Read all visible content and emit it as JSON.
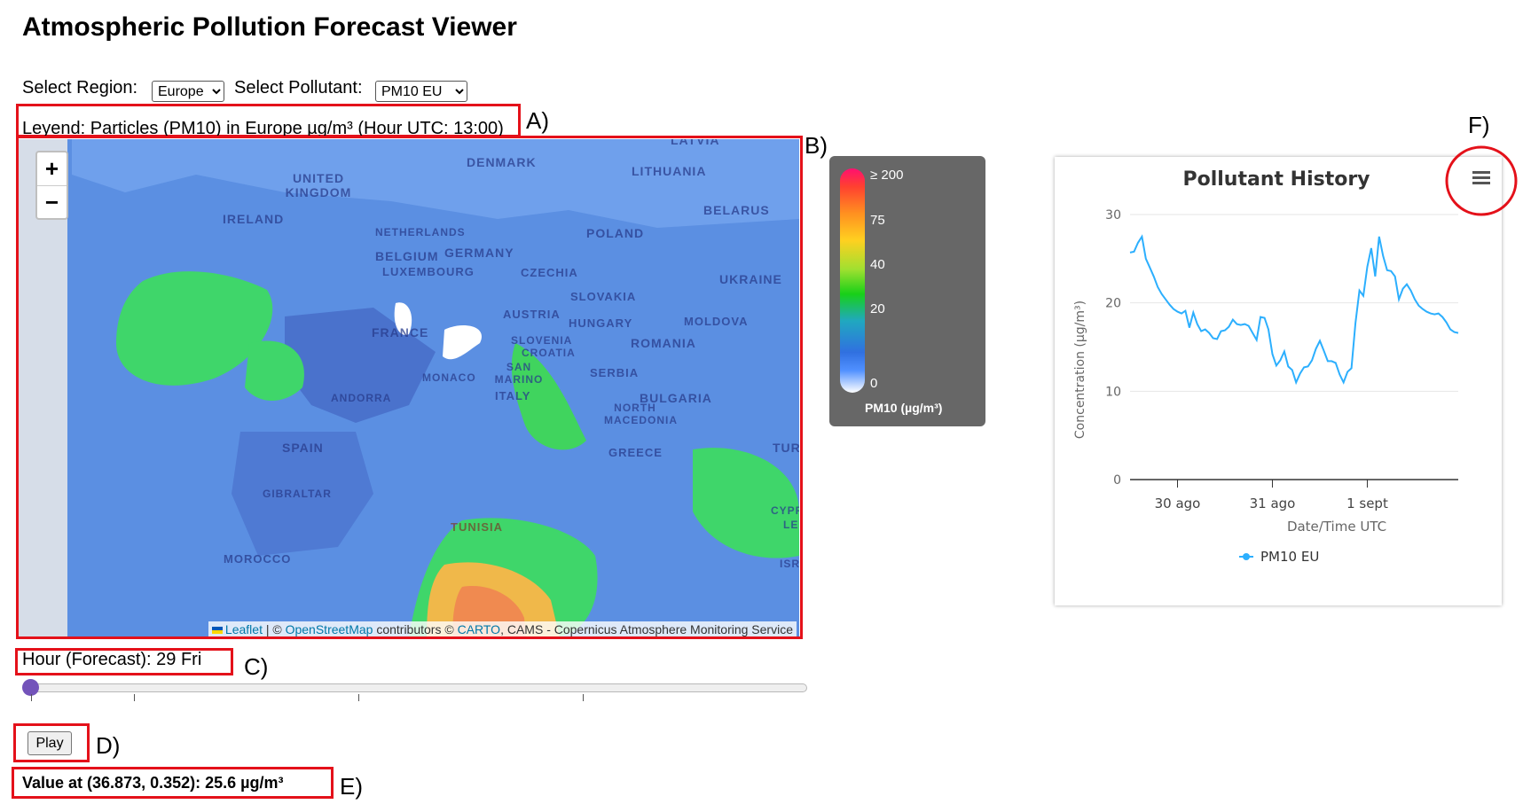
{
  "app": {
    "title": "Atmospheric Pollution Forecast Viewer"
  },
  "controls": {
    "region_label": "Select Region:",
    "region_value": "Europe",
    "pollutant_label": "Select Pollutant:",
    "pollutant_value": "PM10 EU"
  },
  "legend_text": "Leyend: Particles (PM10) in Europe µg/m³ (Hour UTC: 13:00)",
  "annotations": {
    "a": "A)",
    "b": "B)",
    "c": "C)",
    "d": "D)",
    "e": "E)",
    "f": "F)"
  },
  "map": {
    "zoom_in": "+",
    "zoom_out": "−",
    "attribution": {
      "leaflet": "Leaflet",
      "sep1": " | © ",
      "osm": "OpenStreetMap",
      "mid": " contributors © ",
      "carto": "CARTO",
      "rest": ", CAMS - Copernicus Atmosphere Monitoring Service"
    },
    "countries": [
      "LATVIA",
      "DENMARK",
      "LITHUANIA",
      "UNITED KINGDOM",
      "IRELAND",
      "BELARUS",
      "NETHERLANDS",
      "POLAND",
      "BELGIUM",
      "GERMANY",
      "LUXEMBOURG",
      "CZECHIA",
      "UKRAINE",
      "SLOVAKIA",
      "AUSTRIA",
      "HUNGARY",
      "MOLDOVA",
      "FRANCE",
      "SLOVENIA",
      "CROATIA",
      "ROMANIA",
      "SAN MARINO",
      "MONACO",
      "SERBIA",
      "ITALY",
      "ANDORRA",
      "BULGARIA",
      "NORTH MACEDONIA",
      "SPAIN",
      "GREECE",
      "TUR",
      "GIBRALTAR",
      "TUNISIA",
      "CYPRUS",
      "LEB",
      "MOROCCO",
      "ISR"
    ]
  },
  "colorbar": {
    "ticks": [
      "≥ 200",
      "75",
      "40",
      "20",
      "0"
    ],
    "title": "PM10 (µg/m³)"
  },
  "hour": {
    "label": "Hour (Forecast): 29 Fri",
    "slider_position": 0
  },
  "play_label": "Play",
  "value_readout": "Value at (36.873, 0.352): 25.6 µg/m³",
  "chart_data": {
    "type": "line",
    "title": "Pollutant History",
    "xlabel": "Date/Time UTC",
    "ylabel": "Concentration (µg/m³)",
    "ylim": [
      0,
      30
    ],
    "yticks": [
      "0",
      "10",
      "20",
      "30"
    ],
    "xticks": [
      "30 ago",
      "31 ago",
      "1 sept"
    ],
    "xticks_hours": [
      24,
      48,
      72
    ],
    "x_range_hours": [
      12,
      95
    ],
    "grid": true,
    "legend_position": "bottom",
    "series": [
      {
        "name": "PM10 EU",
        "color": "#2caffe",
        "x_hours": [
          12,
          13,
          14,
          15,
          16,
          17,
          18,
          19,
          20,
          21,
          22,
          23,
          24,
          25,
          26,
          27,
          28,
          29,
          30,
          31,
          32,
          33,
          34,
          35,
          36,
          37,
          38,
          39,
          40,
          41,
          42,
          43,
          44,
          45,
          46,
          47,
          48,
          49,
          50,
          51,
          52,
          53,
          54,
          55,
          56,
          57,
          58,
          59,
          60,
          61,
          62,
          63,
          64,
          65,
          66,
          67,
          68,
          69,
          70,
          71,
          72,
          73,
          74,
          75,
          76,
          77,
          78,
          79,
          80,
          81,
          82,
          83,
          84,
          85,
          86,
          87,
          88,
          89,
          90,
          91,
          92,
          93,
          94,
          95
        ],
        "values": [
          25.7,
          25.8,
          26.8,
          27.5,
          25.0,
          24.0,
          23.0,
          21.8,
          21.0,
          20.4,
          19.8,
          19.3,
          19.0,
          18.8,
          19.1,
          17.2,
          18.9,
          17.6,
          16.8,
          17.0,
          16.6,
          16.0,
          15.9,
          16.8,
          16.9,
          17.3,
          18.1,
          17.6,
          17.5,
          17.6,
          17.4,
          16.6,
          15.8,
          18.4,
          18.3,
          17.0,
          14.2,
          12.9,
          13.5,
          14.5,
          12.8,
          12.4,
          11.0,
          12.0,
          12.7,
          12.8,
          13.5,
          14.8,
          15.7,
          14.6,
          13.4,
          13.4,
          13.2,
          11.9,
          11.0,
          12.2,
          12.6,
          17.7,
          21.4,
          20.8,
          24.1,
          26.2,
          23.0,
          27.5,
          25.3,
          23.7,
          23.6,
          23.0,
          20.4,
          21.6,
          22.1,
          21.4,
          20.4,
          19.7,
          19.3,
          19.0,
          18.8,
          18.7,
          18.8,
          18.4,
          17.8,
          17.0,
          16.7,
          16.6
        ]
      }
    ]
  }
}
